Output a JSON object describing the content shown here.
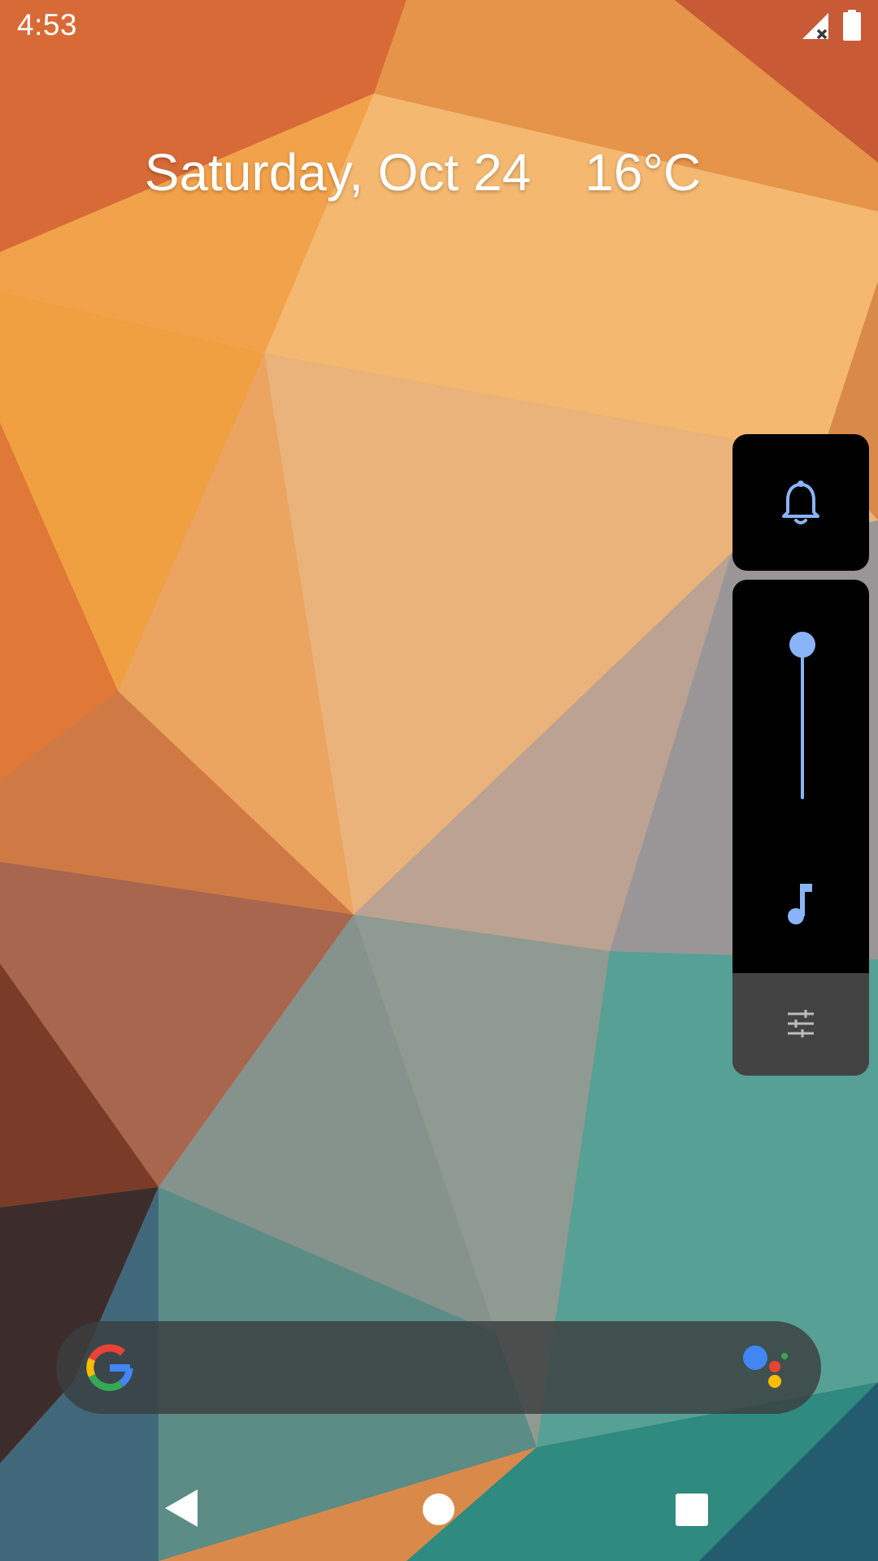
{
  "status_bar": {
    "time": "4:53",
    "signal_icon": "signal-no-service-icon",
    "battery_icon": "battery-full-icon"
  },
  "glance": {
    "date": "Saturday, Oct 24",
    "temperature": "16°C"
  },
  "volume_panel": {
    "ringer_icon": "bell-icon",
    "stream_icon": "music-note-icon",
    "settings_icon": "tune-sliders-icon",
    "level_fraction": 1.0,
    "accent_color": "#8ab4f8",
    "panel_color": "#000000",
    "settings_strip_color": "#434343"
  },
  "search_bar": {
    "placeholder": "",
    "logo_icon": "google-g-icon",
    "assistant_icon": "google-assistant-icon"
  },
  "nav_bar": {
    "back_icon": "back-triangle-icon",
    "home_icon": "home-circle-icon",
    "recents_icon": "recents-square-icon"
  }
}
